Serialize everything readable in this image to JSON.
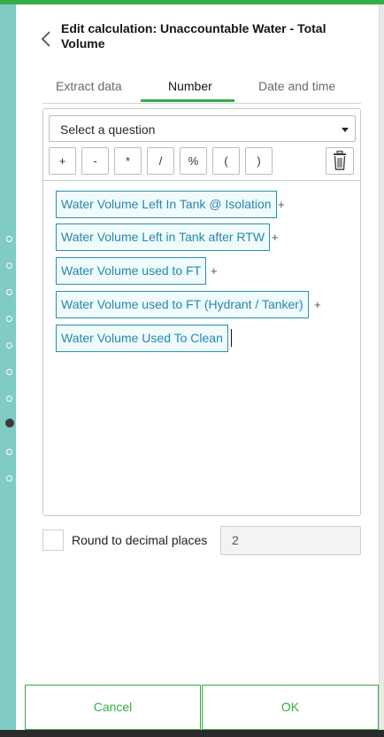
{
  "header": {
    "title": "Edit calculation: Unaccountable Water - Total Volume"
  },
  "tabs": [
    {
      "label": "Extract data"
    },
    {
      "label": "Number",
      "active": true
    },
    {
      "label": "Date and time"
    }
  ],
  "question_select": {
    "placeholder": "Select a question"
  },
  "operators": [
    "+",
    "-",
    "*",
    "/",
    "%",
    "(",
    ")"
  ],
  "formula": {
    "terms": [
      {
        "label": "Water Volume Left In Tank @ Isolation",
        "op": "+"
      },
      {
        "label": "Water Volume Left in Tank after RTW",
        "op": "+"
      },
      {
        "label": "Water Volume used to FT",
        "op": "+"
      },
      {
        "label": "Water Volume used to FT (Hydrant / Tanker)",
        "op": "+"
      },
      {
        "label": "Water Volume Used To Clean",
        "op": ""
      }
    ]
  },
  "round": {
    "label": "Round to decimal places",
    "value": "2",
    "checked": false
  },
  "footer": {
    "cancel_label": "Cancel",
    "ok_label": "OK"
  },
  "colors": {
    "accent": "#35ac46",
    "chip_border": "#2a8fb3",
    "chip_text": "#2986ad",
    "strip": "#80cbc4"
  },
  "icons": {
    "back": "chevron-left-icon",
    "dropdown": "caret-down-icon",
    "delete": "trash-icon"
  }
}
